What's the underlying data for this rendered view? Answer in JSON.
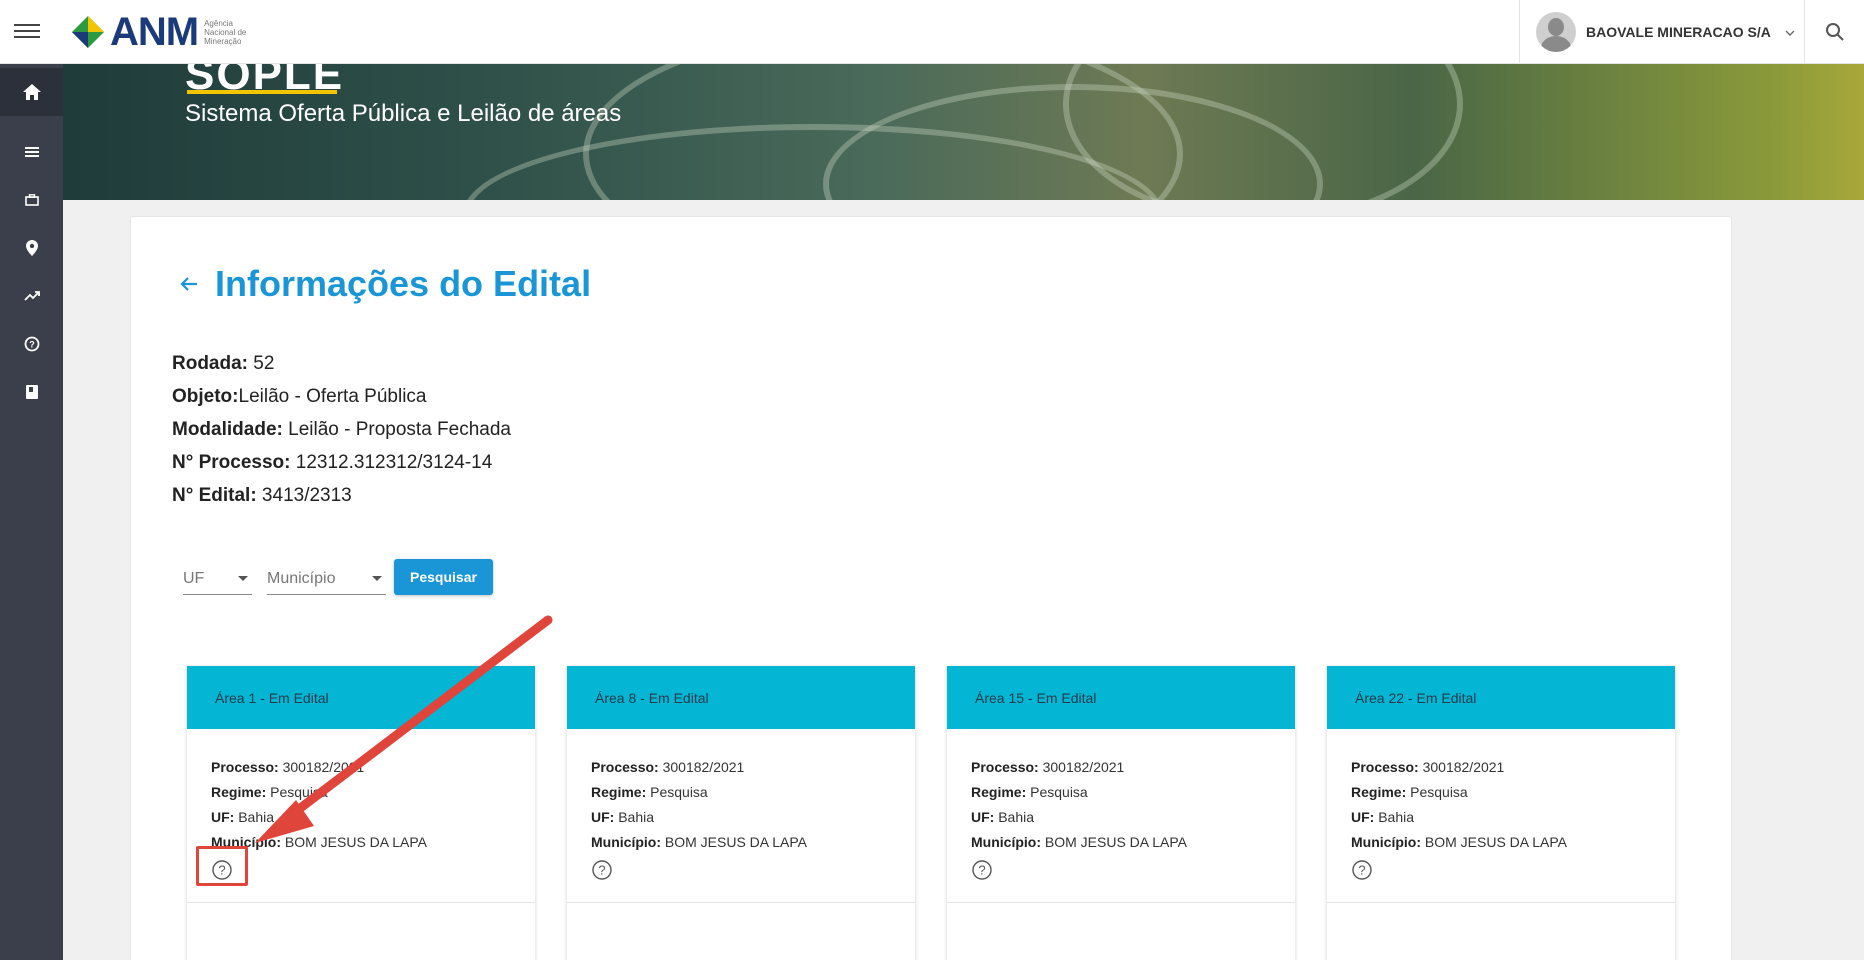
{
  "header": {
    "logo_text": "ANM",
    "logo_subtitle": "Agência Nacional de Mineração",
    "user_name": "BAOVALE MINERACAO S/A"
  },
  "banner": {
    "title": "SOPLE",
    "subtitle": "Sistema Oferta Pública e Leilão de áreas"
  },
  "page": {
    "title": "Informações do Edital"
  },
  "info": {
    "rodada_label": "Rodada:",
    "rodada_value": " 52",
    "objeto_label": "Objeto:",
    "objeto_value": "Leilão - Oferta Pública",
    "modalidade_label": "Modalidade:",
    "modalidade_value": " Leilão - Proposta Fechada",
    "processo_label": "N° Processo:",
    "processo_value": " 12312.312312/3124-14",
    "edital_label": "N° Edital:",
    "edital_value": " 3413/2313"
  },
  "filters": {
    "uf_label": "UF",
    "municipio_label": "Município",
    "search_button": "Pesquisar"
  },
  "labels": {
    "processo": "Processo:",
    "regime": "Regime:",
    "uf": "UF:",
    "municipio": "Município:"
  },
  "areas": [
    {
      "title": "Área 1 - Em Edital",
      "processo": " 300182/2021",
      "regime": " Pesquisa",
      "uf": " Bahia",
      "municipio": " BOM JESUS DA LAPA"
    },
    {
      "title": "Área 8 - Em Edital",
      "processo": " 300182/2021",
      "regime": " Pesquisa",
      "uf": " Bahia",
      "municipio": " BOM JESUS DA LAPA"
    },
    {
      "title": "Área 15 - Em Edital",
      "processo": " 300182/2021",
      "regime": " Pesquisa",
      "uf": " Bahia",
      "municipio": " BOM JESUS DA LAPA"
    },
    {
      "title": "Área 22 - Em Edital",
      "processo": " 300182/2021",
      "regime": " Pesquisa",
      "uf": " Bahia",
      "municipio": " BOM JESUS DA LAPA"
    }
  ],
  "colors": {
    "accent": "#1a96d6",
    "card_header": "#05b5d4",
    "sidebar": "#3a3f4b",
    "banner_underline": "#f2c500",
    "annotation": "#e0453c"
  },
  "icons": {
    "menu": "hamburger-icon",
    "search": "search-icon",
    "home": "home-icon",
    "list": "list-icon",
    "briefcase": "briefcase-icon",
    "location": "location-pin-icon",
    "trend": "trending-up-icon",
    "help": "help-circle-icon",
    "book": "book-icon",
    "back": "arrow-left-icon"
  }
}
